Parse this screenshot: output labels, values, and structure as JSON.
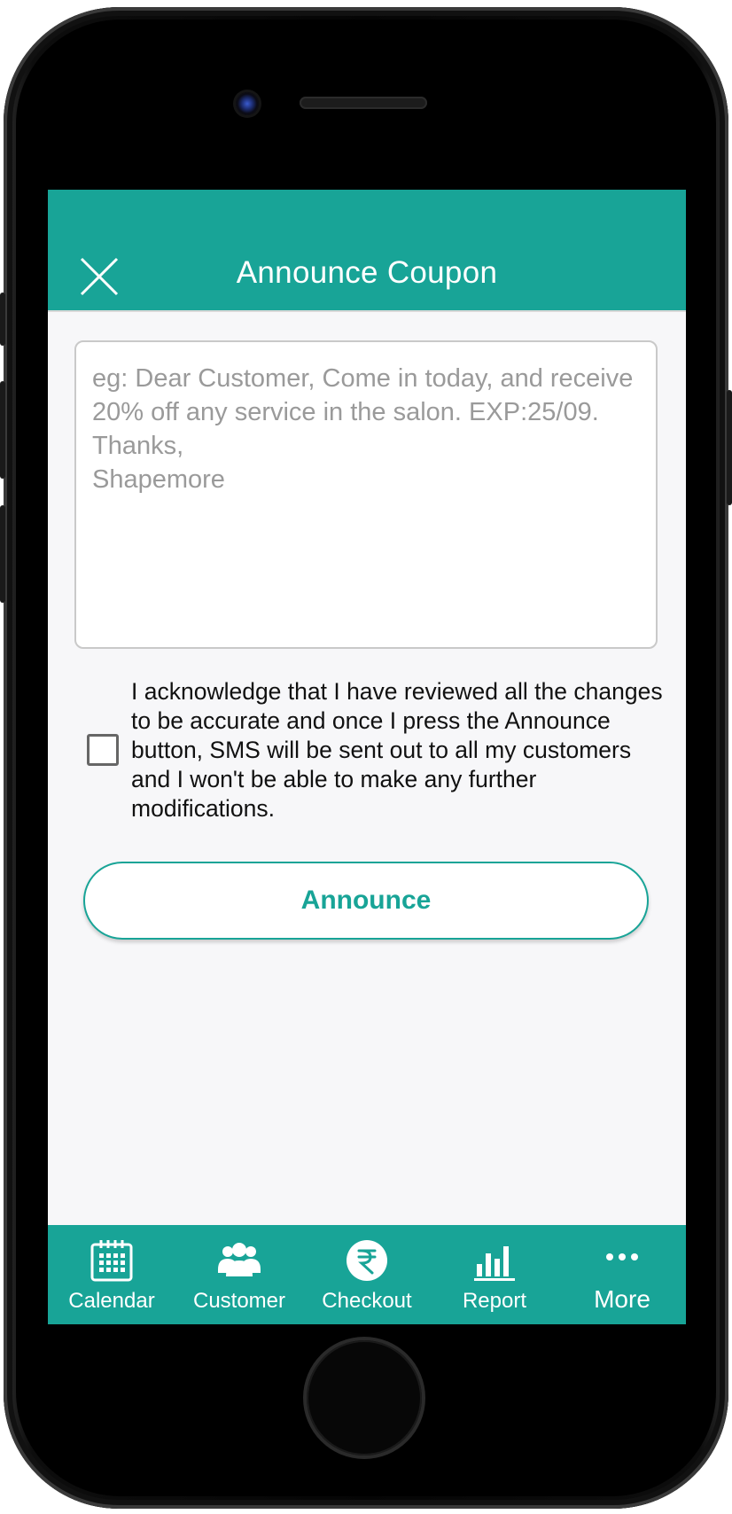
{
  "header": {
    "title": "Announce Coupon",
    "close_icon": "close-icon"
  },
  "message": {
    "placeholder": "eg: Dear Customer, Come in today, and receive 20% off any service in the salon. EXP:25/09.\nThanks,\nShapemore",
    "value": ""
  },
  "acknowledgement": {
    "checked": false,
    "text": "I acknowledge that I have reviewed all the changes to be accurate and once I press the Announce button, SMS will be sent out to all my customers and I won't be able to make any further modifications."
  },
  "actions": {
    "announce_label": "Announce"
  },
  "bottom_nav": {
    "items": [
      {
        "label": "Calendar",
        "icon": "calendar-icon"
      },
      {
        "label": "Customer",
        "icon": "customers-icon"
      },
      {
        "label": "Checkout",
        "icon": "rupee-icon"
      },
      {
        "label": "Report",
        "icon": "bar-chart-icon"
      },
      {
        "label": "More",
        "icon": "more-dots-icon"
      }
    ]
  },
  "colors": {
    "primary": "#18a497",
    "background": "#f7f7f9"
  }
}
